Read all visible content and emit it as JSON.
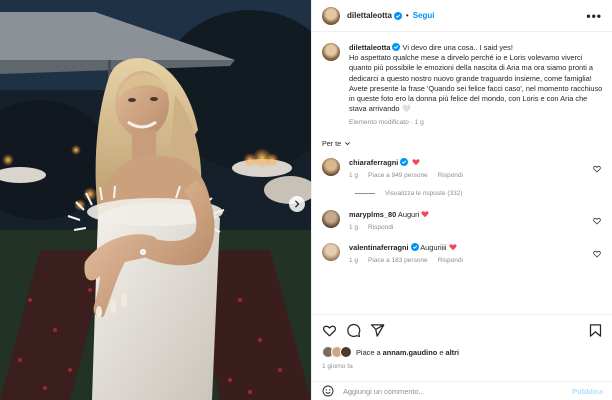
{
  "post": {
    "author": {
      "username": "dilettaleotta",
      "verified": true
    },
    "follow_label": "Segui",
    "more_label": "•••",
    "caption": {
      "username": "dilettaleotta",
      "text": " Vi devo dire una cosa.. I said yes!\nHo aspettato qualche mese a dirvelo perché io e Loris volevamo viverci quanto più possibile le emozioni della nascita di Aria ma ora siamo pronti a dedicarci a questo nostro nuovo grande traguardo insieme, come famiglia! Avete presente la frase 'Quando sei felice facci caso', nel momento racchiuso in queste foto ero la donna più felice del mondo, con Loris e con Aria che stava arrivando 🤍",
      "meta": "Elemento modificato · 1 g"
    },
    "filter_label": "Per te",
    "comments": [
      {
        "username": "chiaraferragni",
        "verified": true,
        "text": "",
        "heart": "❤️",
        "time": "1 g",
        "likes": "Piace a 949 persone",
        "reply": "Rispondi",
        "view_replies": "Visualizza le risposte (332)"
      },
      {
        "username": "maryplms_80",
        "verified": false,
        "text": "Auguri",
        "heart": "❤️",
        "time": "1 g",
        "likes": "",
        "reply": "Rispondi",
        "view_replies": ""
      },
      {
        "username": "valentinaferragni",
        "verified": true,
        "text": "Auguriiii",
        "heart": "❤️",
        "time": "1 g",
        "likes": "Piace a 183 persone",
        "reply": "Rispondi",
        "view_replies": ""
      }
    ],
    "likes_prefix": "Piace a ",
    "likes_user": "annam.gaudino",
    "likes_middle": " e ",
    "likes_others": "altri",
    "posted_time": "1 giorno fa",
    "comment_placeholder": "Aggiungi un commento...",
    "publish_label": "Pubblica"
  },
  "colors": {
    "accent": "#0095f6",
    "verified": "#0095f6",
    "heart": "#ed4956",
    "muted": "#8e8e8e",
    "text": "#262626"
  },
  "icons": {
    "carousel": "chevron-right-icon",
    "actions": [
      "heart-icon",
      "comment-icon",
      "share-icon",
      "bookmark-icon"
    ],
    "composer": "emoji-icon"
  }
}
